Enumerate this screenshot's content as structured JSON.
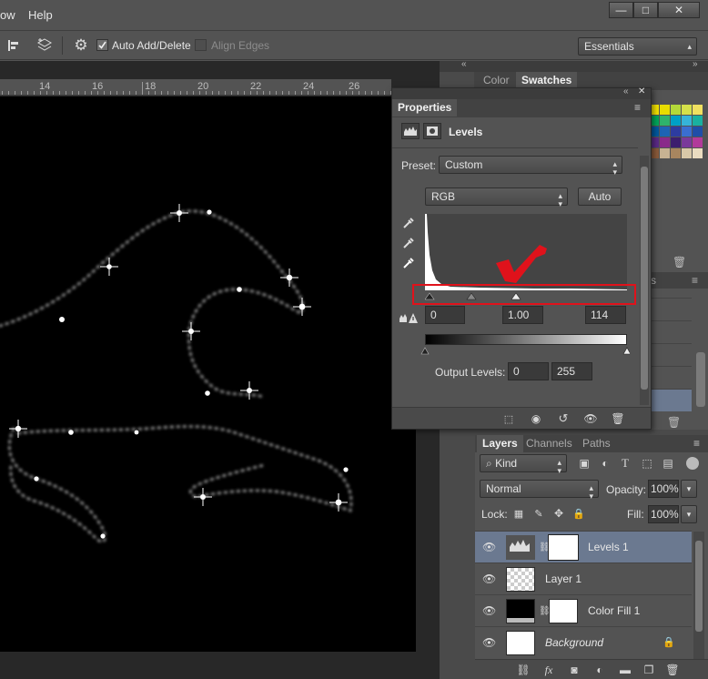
{
  "menubar": {
    "items": [
      "ow",
      "Help"
    ],
    "window_buttons": [
      "—",
      "□",
      "✕"
    ]
  },
  "options": {
    "auto_add_delete": "Auto Add/Delete",
    "align_edges": "Align Edges",
    "workspace": "Essentials"
  },
  "ruler": {
    "labels": [
      "14",
      "16",
      "18",
      "20",
      "22",
      "24",
      "26"
    ]
  },
  "top_panel": {
    "tabs": [
      "Color",
      "Swatches"
    ],
    "swatch_colors": [
      "#f2e200",
      "#e8dd00",
      "#b4d93a",
      "#d4e04a",
      "#f0e060",
      "#00a65a",
      "#2fb36c",
      "#00a0c6",
      "#36b4d8",
      "#1ab0a0",
      "#00589e",
      "#1e64b4",
      "#2d3ca0",
      "#3a6ed0",
      "#1f4ea8",
      "#5a2a86",
      "#8a2a8a",
      "#3c1e6e",
      "#7a3a9a",
      "#b23a9a",
      "#8a5a3a",
      "#c7b393",
      "#a8865f",
      "#d8c8a8",
      "#eadcc0"
    ]
  },
  "properties": {
    "tab": "Properties",
    "title": "Levels",
    "preset_label": "Preset:",
    "preset_value": "Custom",
    "channel": "RGB",
    "auto": "Auto",
    "input_black": "0",
    "input_gamma": "1.00",
    "input_white": "114",
    "output_label": "Output Levels:",
    "output_black": "0",
    "output_white": "255",
    "annotation_color": "#e0121b"
  },
  "layers": {
    "tabs": [
      "Layers",
      "Channels",
      "Paths"
    ],
    "kind": "Kind",
    "blend_mode": "Normal",
    "opacity_label": "Opacity:",
    "opacity": "100%",
    "lock_label": "Lock:",
    "fill_label": "Fill:",
    "fill": "100%",
    "rows": [
      {
        "name": "Levels 1",
        "selected": true
      },
      {
        "name": "Layer 1",
        "selected": false
      },
      {
        "name": "Color Fill 1",
        "selected": false
      },
      {
        "name": "Background",
        "selected": false
      }
    ],
    "footer_icons": [
      "link-icon",
      "fx-icon",
      "mask-icon",
      "adjustment-icon",
      "folder-icon",
      "new-layer-icon",
      "trash-icon"
    ]
  }
}
